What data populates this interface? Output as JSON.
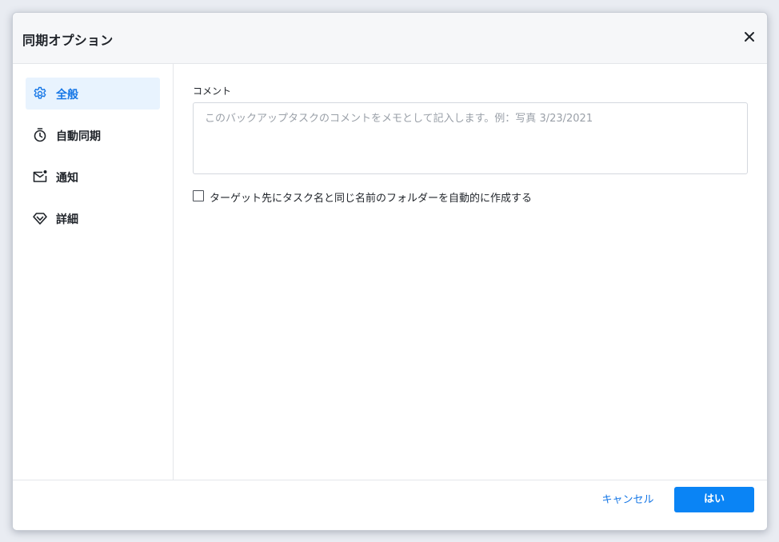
{
  "dialog": {
    "title": "同期オプション"
  },
  "sidebar": {
    "items": [
      {
        "label": "全般",
        "icon": "gear-icon",
        "active": true
      },
      {
        "label": "自動同期",
        "icon": "stopwatch-icon",
        "active": false
      },
      {
        "label": "通知",
        "icon": "mail-notification-icon",
        "active": false
      },
      {
        "label": "詳細",
        "icon": "diamond-icon",
        "active": false
      }
    ]
  },
  "main": {
    "comment_label": "コメント",
    "comment_value": "",
    "comment_placeholder": "このバックアップタスクのコメントをメモとして記入します。例：写真 3/23/2021",
    "create_folder_checkbox": {
      "label": "ターゲット先にタスク名と同じ名前のフォルダーを自動的に作成する",
      "checked": false
    }
  },
  "footer": {
    "cancel_label": "キャンセル",
    "ok_label": "はい"
  },
  "colors": {
    "accent": "#0a84f5",
    "active_text": "#1677e6",
    "active_bg": "#e8f3fe"
  }
}
